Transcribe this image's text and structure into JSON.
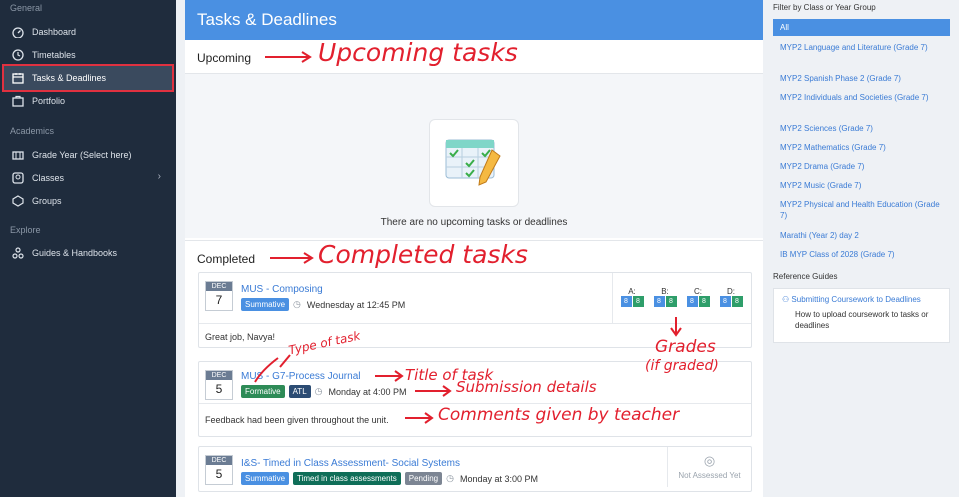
{
  "sidebar": {
    "section_general": "General",
    "section_academics": "Academics",
    "section_explore": "Explore",
    "items": [
      {
        "label": "Dashboard",
        "icon": "dashboard-icon"
      },
      {
        "label": "Timetables",
        "icon": "clock-icon"
      },
      {
        "label": "Tasks & Deadlines",
        "icon": "calendar-icon"
      },
      {
        "label": "Portfolio",
        "icon": "portfolio-icon"
      },
      {
        "label": "Grade Year (Select here)",
        "icon": "grade-icon"
      },
      {
        "label": "Classes",
        "icon": "classes-icon"
      },
      {
        "label": "Groups",
        "icon": "groups-icon"
      },
      {
        "label": "Guides & Handbooks",
        "icon": "guides-icon"
      }
    ]
  },
  "main": {
    "title": "Tasks & Deadlines",
    "upcoming_title": "Upcoming",
    "empty_text": "There are no upcoming tasks or deadlines",
    "completed_title": "Completed",
    "tasks": [
      {
        "month": "DEC",
        "day": "7",
        "title": "MUS - Composing",
        "badges": [
          "Summative"
        ],
        "when": "Wednesday at 12:45 PM",
        "comment": "Great job, Navya!",
        "grades": [
          {
            "label": "A:",
            "values": [
              "8",
              "8"
            ]
          },
          {
            "label": "B:",
            "values": [
              "8",
              "8"
            ]
          },
          {
            "label": "C:",
            "values": [
              "8",
              "8"
            ]
          },
          {
            "label": "D:",
            "values": [
              "8",
              "8"
            ]
          }
        ]
      },
      {
        "month": "DEC",
        "day": "5",
        "title": "MUS - G7-Process Journal",
        "badges": [
          "Formative",
          "ATL"
        ],
        "when": "Monday at 4:00 PM",
        "comment": "Feedback had been given throughout the unit."
      },
      {
        "month": "DEC",
        "day": "5",
        "title": "I&S- Timed in Class Assessment- Social Systems",
        "badges": [
          "Summative",
          "Timed in class assessments",
          "Pending"
        ],
        "when": "Monday at 3:00 PM",
        "status": "Not Assessed Yet"
      }
    ]
  },
  "filter": {
    "title": "Filter by Class or Year Group",
    "all": "All",
    "items": [
      "MYP2 Language and Literature (Grade 7)",
      "MYP2 Spanish Phase 2 (Grade 7)",
      "MYP2 Individuals and Societies (Grade 7)",
      "MYP2 Sciences (Grade 7)",
      "MYP2 Mathematics (Grade 7)",
      "MYP2 Drama (Grade 7)",
      "MYP2 Music (Grade 7)",
      "MYP2 Physical and Health Education (Grade 7)",
      "Marathi (Year 2) day 2",
      "IB MYP Class of 2028 (Grade 7)"
    ]
  },
  "reference": {
    "title": "Reference Guides",
    "link": "Submitting Coursework to Deadlines",
    "desc": "How to upload coursework to tasks or deadlines"
  },
  "annotations": {
    "upcoming": "Upcoming tasks",
    "completed": "Completed tasks",
    "type": "Type of task",
    "title": "Title of task",
    "submission": "Submission details",
    "comments": "Comments given by teacher",
    "grades": "Grades",
    "graded": "(if graded)"
  },
  "colors": {
    "sidebar": "#1f2c3d",
    "accent": "#4a90e2",
    "annotation": "#e2202e"
  }
}
